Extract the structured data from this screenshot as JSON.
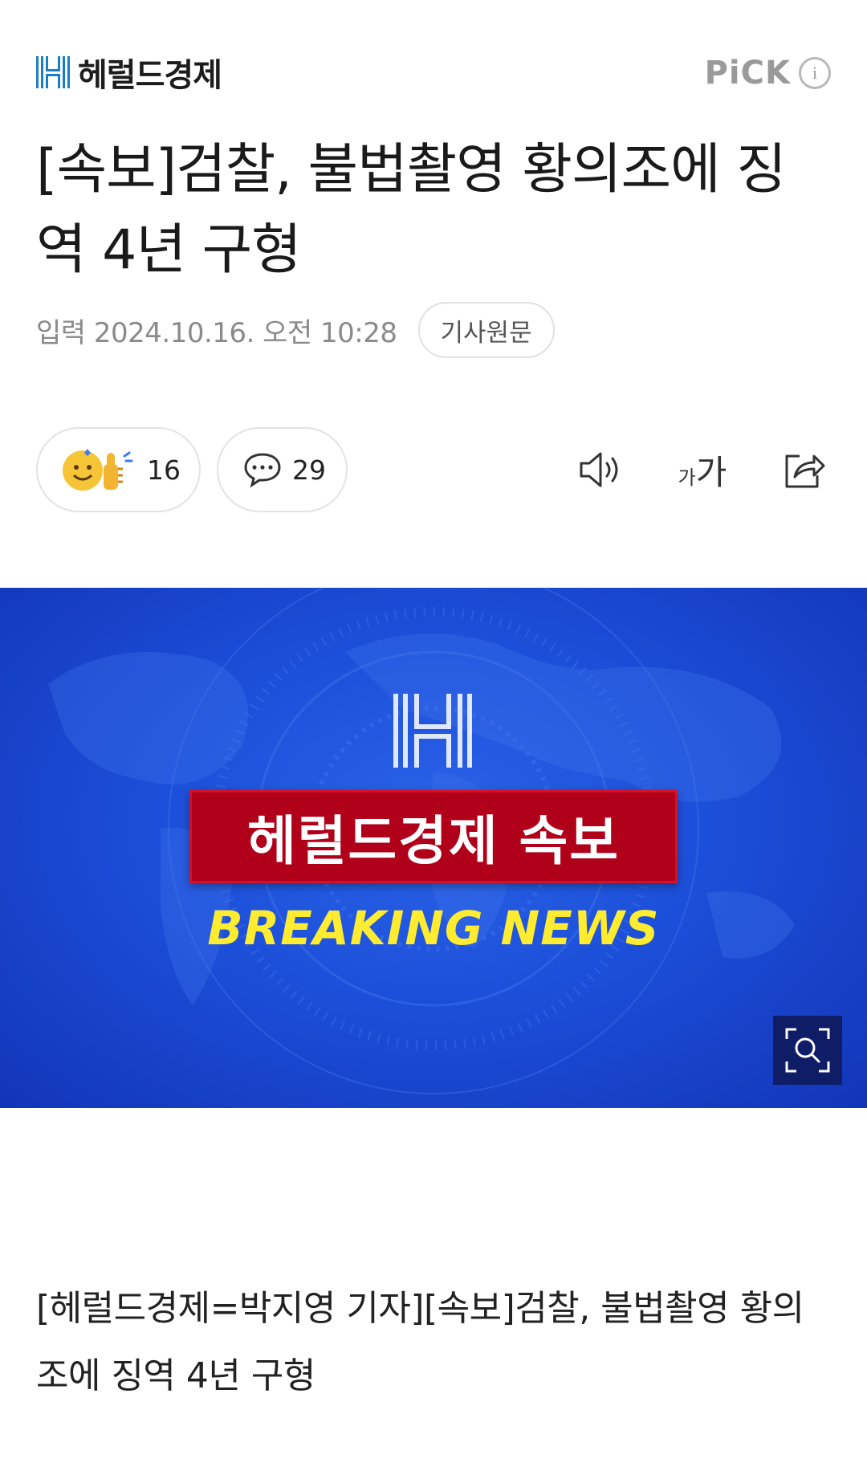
{
  "header": {
    "brand": "헤럴드경제",
    "pick_label": "PiCK",
    "info_icon": "info-icon"
  },
  "article": {
    "title": "[속보]검찰, 불법촬영 황의조에 징역 4년 구형",
    "published": "입력 2024.10.16. 오전 10:28",
    "source_button": "기사원문",
    "reaction_count": "16",
    "comment_count": "29",
    "font_small": "가",
    "font_big": "가",
    "body": "[헤럴드경제=박지영 기자][속보]검찰, 불법촬영 황의조에 징역 4년 구형"
  },
  "banner": {
    "title": "헤럴드경제 속보",
    "subtitle": "BREAKING NEWS"
  },
  "icons": {
    "reaction": "smile-thumbs-up-icon",
    "comment": "comment-bubble-icon",
    "audio": "speaker-icon",
    "font": "font-size-icon",
    "share": "share-icon",
    "zoom": "zoom-image-icon"
  },
  "colors": {
    "banner_blue": "#1c4fd9",
    "banner_red": "#b0001a",
    "banner_yellow": "#ffec30",
    "logo_blue": "#1a7fc8"
  }
}
